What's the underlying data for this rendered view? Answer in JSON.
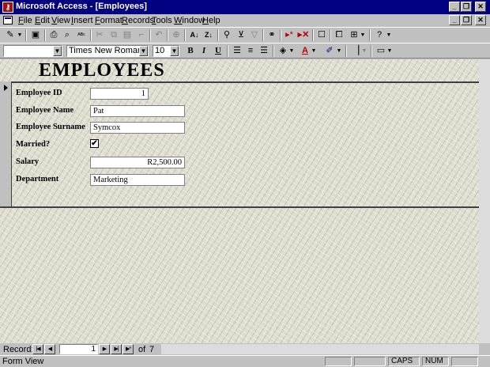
{
  "window": {
    "title": "Microsoft Access - [Employees]",
    "app_icon": "key-icon",
    "caption_buttons": [
      "_",
      "❐",
      "✕"
    ]
  },
  "doc_buttons": [
    "_",
    "❐",
    "✕"
  ],
  "menu": [
    "File",
    "Edit",
    "View",
    "Insert",
    "Format",
    "Records",
    "Tools",
    "Window",
    "Help"
  ],
  "toolbar1": {
    "icons": [
      "view-design-icon",
      "save-icon",
      "print-icon",
      "print-preview-icon",
      "spelling-icon",
      "cut-icon",
      "copy-icon",
      "paste-icon",
      "format-painter-icon",
      "undo-icon",
      "insert-hyperlink-icon",
      "sort-ascending-icon",
      "sort-descending-icon",
      "filter-by-selection-icon",
      "filter-by-form-icon",
      "apply-filter-icon",
      "find-icon",
      "new-record-icon",
      "delete-record-icon",
      "properties-icon",
      "database-window-icon",
      "new-object-icon",
      "help-icon"
    ]
  },
  "toolbar2": {
    "object_combo": "",
    "font_name": "Times New Roman",
    "font_size": "10",
    "bold": "B",
    "italic": "I",
    "underline": "U"
  },
  "form": {
    "title": "EMPLOYEES",
    "fields": [
      {
        "label": "Employee ID",
        "value": "1",
        "align": "right"
      },
      {
        "label": "Employee Name",
        "value": "Pat"
      },
      {
        "label": "Employee Surname",
        "value": "Symcox"
      },
      {
        "label": "Married?",
        "value": "✔",
        "type": "checkbox"
      },
      {
        "label": "Salary",
        "value": "R2,500.00",
        "align": "right"
      },
      {
        "label": "Department",
        "value": "Marketing"
      }
    ]
  },
  "navigation": {
    "label": "Record:",
    "current": "1",
    "of": "of",
    "total": "7"
  },
  "status": {
    "text": "Form View",
    "caps": "CAPS",
    "num": "NUM"
  },
  "colors": {
    "titlebar": "#000080",
    "chrome": "#c0c0c0",
    "form_background": "#deded0"
  }
}
